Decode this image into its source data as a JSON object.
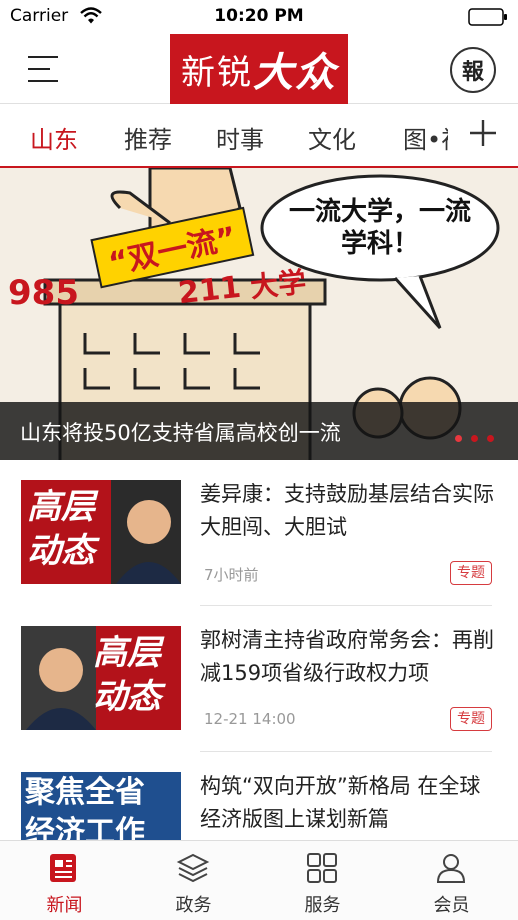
{
  "status_bar": {
    "carrier": "Carrier",
    "time": "10:20 PM"
  },
  "header": {
    "logo_text": "新锐",
    "logo_text_big": "大众",
    "paper_label": "報"
  },
  "tabs": [
    {
      "label": "山东",
      "active": true
    },
    {
      "label": "推荐"
    },
    {
      "label": "时事"
    },
    {
      "label": "文化"
    },
    {
      "label": "图•视"
    }
  ],
  "banner": {
    "caption": "山东将投50亿支持省属高校创一流",
    "image_labels": {
      "speech": "一流大学，一流学科！",
      "rank_985": "985",
      "double": "“双一流”",
      "rank_211": "211",
      "university": "大学"
    },
    "slide_count": 3,
    "active_slide": 1
  },
  "news": [
    {
      "title": "姜异康：支持鼓励基层结合实际大胆闯、大胆试",
      "time": "7小时前",
      "badge": "专题",
      "thumb_text": [
        "高层",
        "动态"
      ]
    },
    {
      "title": "郭树清主持省政府常务会：再削减159项省级行政权力项",
      "time": "12-21 14:00",
      "badge": "专题",
      "thumb_text": [
        "高层",
        "动态"
      ]
    },
    {
      "title": "构筑“双向开放”新格局 在全球经济版图上谋划新篇",
      "time": "",
      "badge": "",
      "thumb_text": [
        "聚焦全省",
        "经济工作"
      ]
    }
  ],
  "tabbar": [
    {
      "label": "新闻",
      "icon": "news-icon",
      "active": true
    },
    {
      "label": "政务",
      "icon": "layers-icon"
    },
    {
      "label": "服务",
      "icon": "grid-icon"
    },
    {
      "label": "会员",
      "icon": "user-icon"
    }
  ],
  "colors": {
    "brand_red": "#c8161e",
    "text": "#222222",
    "muted": "#999999"
  }
}
